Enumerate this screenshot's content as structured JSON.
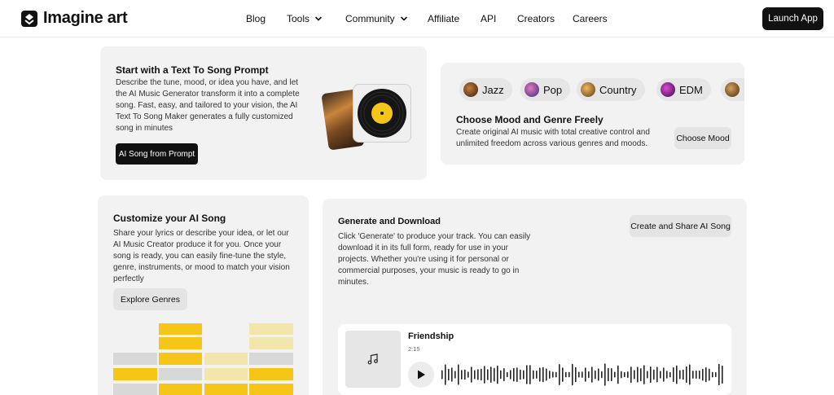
{
  "brand": {
    "name": "Imagine art",
    "accent": "#f5c518",
    "dark": "#111111"
  },
  "nav": {
    "links": [
      {
        "label": "Blog",
        "dropdown": false
      },
      {
        "label": "Tools",
        "dropdown": true
      },
      {
        "label": "Community",
        "dropdown": true
      },
      {
        "label": "Affiliate",
        "dropdown": false
      },
      {
        "label": "API",
        "dropdown": false
      },
      {
        "label": "Creators",
        "dropdown": false
      },
      {
        "label": "Careers",
        "dropdown": false
      }
    ],
    "cta": "Launch App"
  },
  "prompt_card": {
    "title": "Start with a Text To Song Prompt",
    "description": "Describe the tune, mood, or idea you have, and let the AI Music Generator transform it into a complete song. Fast, easy, and tailored to your vision, the AI Text To Song Maker generates a fully customized song in minutes",
    "button": "AI Song from Prompt"
  },
  "mood_card": {
    "chips": [
      {
        "label": "Jazz",
        "icon": "jazz-icon"
      },
      {
        "label": "Pop",
        "icon": "pop-icon"
      },
      {
        "label": "Country",
        "icon": "country-icon"
      },
      {
        "label": "EDM",
        "icon": "edm-icon"
      }
    ],
    "title": "Choose Mood and Genre Freely",
    "description": "Create original AI music with total creative control and unlimited freedom across various genres and moods.",
    "button": "Choose Mood"
  },
  "customize_card": {
    "title": "Customize your AI Song",
    "description": "Share your lyrics or describe your idea, or let our AI Music Creator produce it for you. Once your song is ready, you can easily fine-tune the style, genre, instruments, or mood to match your vision perfectly",
    "button": "Explore Genres"
  },
  "generate_card": {
    "title": "Generate and Download",
    "description": "Click 'Generate' to produce your track. You can easily download it in its full form, ready for use in your projects. Whether you're using it for personal or commercial purposes, your music is ready to go in minutes.",
    "button": "Create and Share AI Song",
    "player": {
      "song_title": "Friendship",
      "duration": "2:15",
      "thumb_icon": "music-note-icon",
      "play_icon": "play-icon"
    }
  }
}
